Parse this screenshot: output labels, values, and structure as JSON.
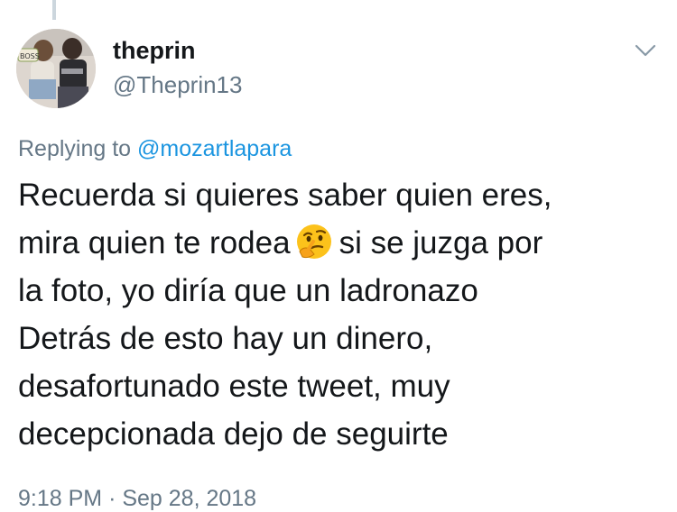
{
  "tweet": {
    "display_name": "theprin",
    "handle": "@Theprin13",
    "avatar_icon": "profile-photo-avatar",
    "avatar_text": "BOSS",
    "menu_icon": "chevron-down-icon",
    "replying_prefix": "Replying to",
    "replying_to": "@mozartlapara",
    "text_lines": {
      "line1": "Recuerda si quieres saber quien eres,",
      "line2_before_emoji": "mira quien te rodea",
      "emoji": "thinking-face-emoji",
      "line2_after_emoji": "si se juzga por",
      "line3": "la foto, yo diría que un ladronazo",
      "line4": "Detrás de esto hay un dinero,",
      "line5": "desafortunado este tweet, muy",
      "line6": "decepcionada dejo de seguirte"
    },
    "time": "9:18 PM",
    "separator": "·",
    "date": "Sep 28, 2018"
  },
  "colors": {
    "text_primary": "#14171a",
    "text_secondary": "#657786",
    "link": "#1b95e0",
    "thread_line": "#ccd6dd",
    "background": "#ffffff"
  }
}
